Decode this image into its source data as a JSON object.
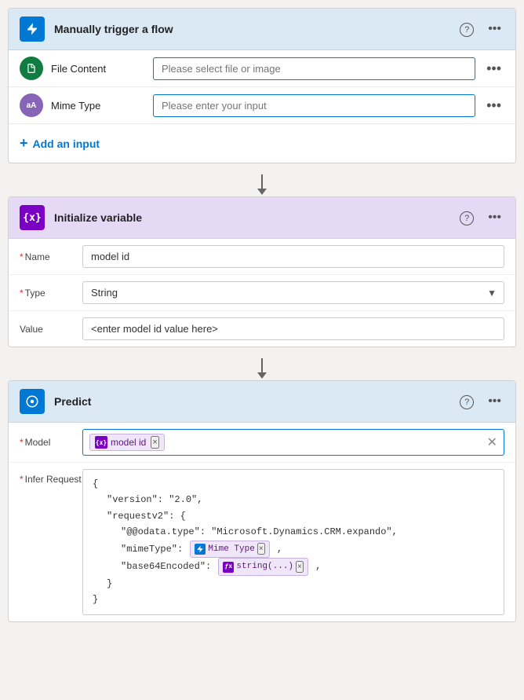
{
  "trigger_card": {
    "title": "Manually trigger a flow",
    "help_icon": "?",
    "more_icon": "...",
    "rows": [
      {
        "icon_label": "D",
        "icon_class": "circle-green",
        "label": "File Content",
        "placeholder": "Please select file or image",
        "more": "..."
      },
      {
        "icon_label": "aA",
        "icon_class": "circle-purple",
        "label": "Mime Type",
        "placeholder": "Please enter your input",
        "more": "..."
      }
    ],
    "add_input_label": "Add an input",
    "add_input_prefix": "+"
  },
  "init_card": {
    "title": "Initialize variable",
    "help_icon": "?",
    "more_icon": "...",
    "fields": [
      {
        "label": "Name",
        "required": true,
        "type": "input",
        "value": "model id"
      },
      {
        "label": "Type",
        "required": true,
        "type": "select",
        "value": "String"
      },
      {
        "label": "Value",
        "required": false,
        "type": "input",
        "value": "<enter model id value here>"
      }
    ]
  },
  "predict_card": {
    "title": "Predict",
    "help_icon": "?",
    "more_icon": "...",
    "model_field": {
      "label": "Model",
      "required": true,
      "chip_label": "model id",
      "chip_icon": "{x}",
      "chip_close": "x"
    },
    "infer_field": {
      "label": "Infer Request",
      "required": true
    },
    "json_lines": [
      {
        "text": "{",
        "indent": 0
      },
      {
        "text": "\"version\": \"2.0\",",
        "indent": 1
      },
      {
        "text": "\"requestv2\": {",
        "indent": 1
      },
      {
        "text": "\"@@odata.type\": \"Microsoft.Dynamics.CRM.expando\",",
        "indent": 2
      },
      {
        "text": "\"mimeType\":",
        "indent": 2,
        "chip": {
          "icon_type": "trigger",
          "label": "Mime Type",
          "close": "x"
        },
        "suffix": ","
      },
      {
        "text": "\"base64Encoded\":",
        "indent": 2,
        "chip": {
          "icon_type": "formula",
          "label": "string(...)",
          "close": "x"
        },
        "suffix": ","
      },
      {
        "text": "}",
        "indent": 1
      },
      {
        "text": "}",
        "indent": 0
      }
    ]
  },
  "icons": {
    "trigger_icon": "⚡",
    "init_icon": "{x}",
    "predict_icon": "🧠",
    "chevron_down": "∨",
    "question_mark": "?"
  }
}
